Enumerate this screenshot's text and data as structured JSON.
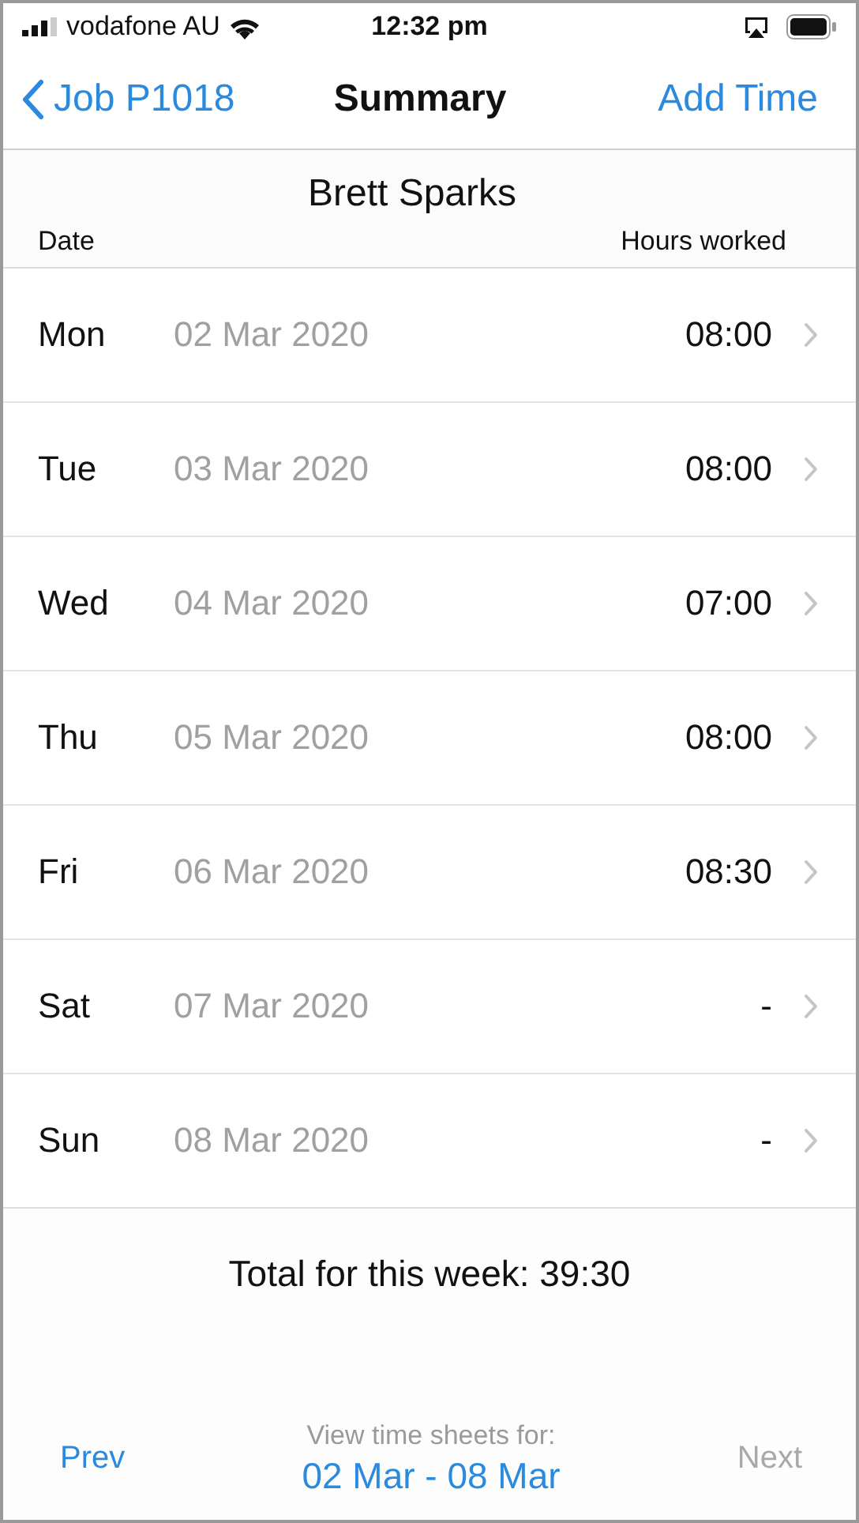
{
  "status_bar": {
    "carrier": "vodafone AU",
    "time": "12:32 pm"
  },
  "nav": {
    "back": "Job P1018",
    "title": "Summary",
    "action": "Add Time"
  },
  "header": {
    "name": "Brett Sparks",
    "columns": [
      "Date",
      "Hours worked"
    ]
  },
  "rows": [
    {
      "day": "Mon",
      "date": "02 Mar 2020",
      "hours": "08:00"
    },
    {
      "day": "Tue",
      "date": "03 Mar 2020",
      "hours": "08:00"
    },
    {
      "day": "Wed",
      "date": "04 Mar 2020",
      "hours": "07:00"
    },
    {
      "day": "Thu",
      "date": "05 Mar 2020",
      "hours": "08:00"
    },
    {
      "day": "Fri",
      "date": "06 Mar 2020",
      "hours": "08:30"
    },
    {
      "day": "Sat",
      "date": "07 Mar 2020",
      "hours": "-"
    },
    {
      "day": "Sun",
      "date": "08 Mar 2020",
      "hours": "-"
    }
  ],
  "total": "Total for this week: 39:30",
  "footer": {
    "prev": {
      "label": "Prev",
      "disabled": false
    },
    "caption": "View time sheets for:",
    "range": "02 Mar - 08 Mar",
    "next": {
      "label": "Next",
      "disabled": true
    }
  }
}
